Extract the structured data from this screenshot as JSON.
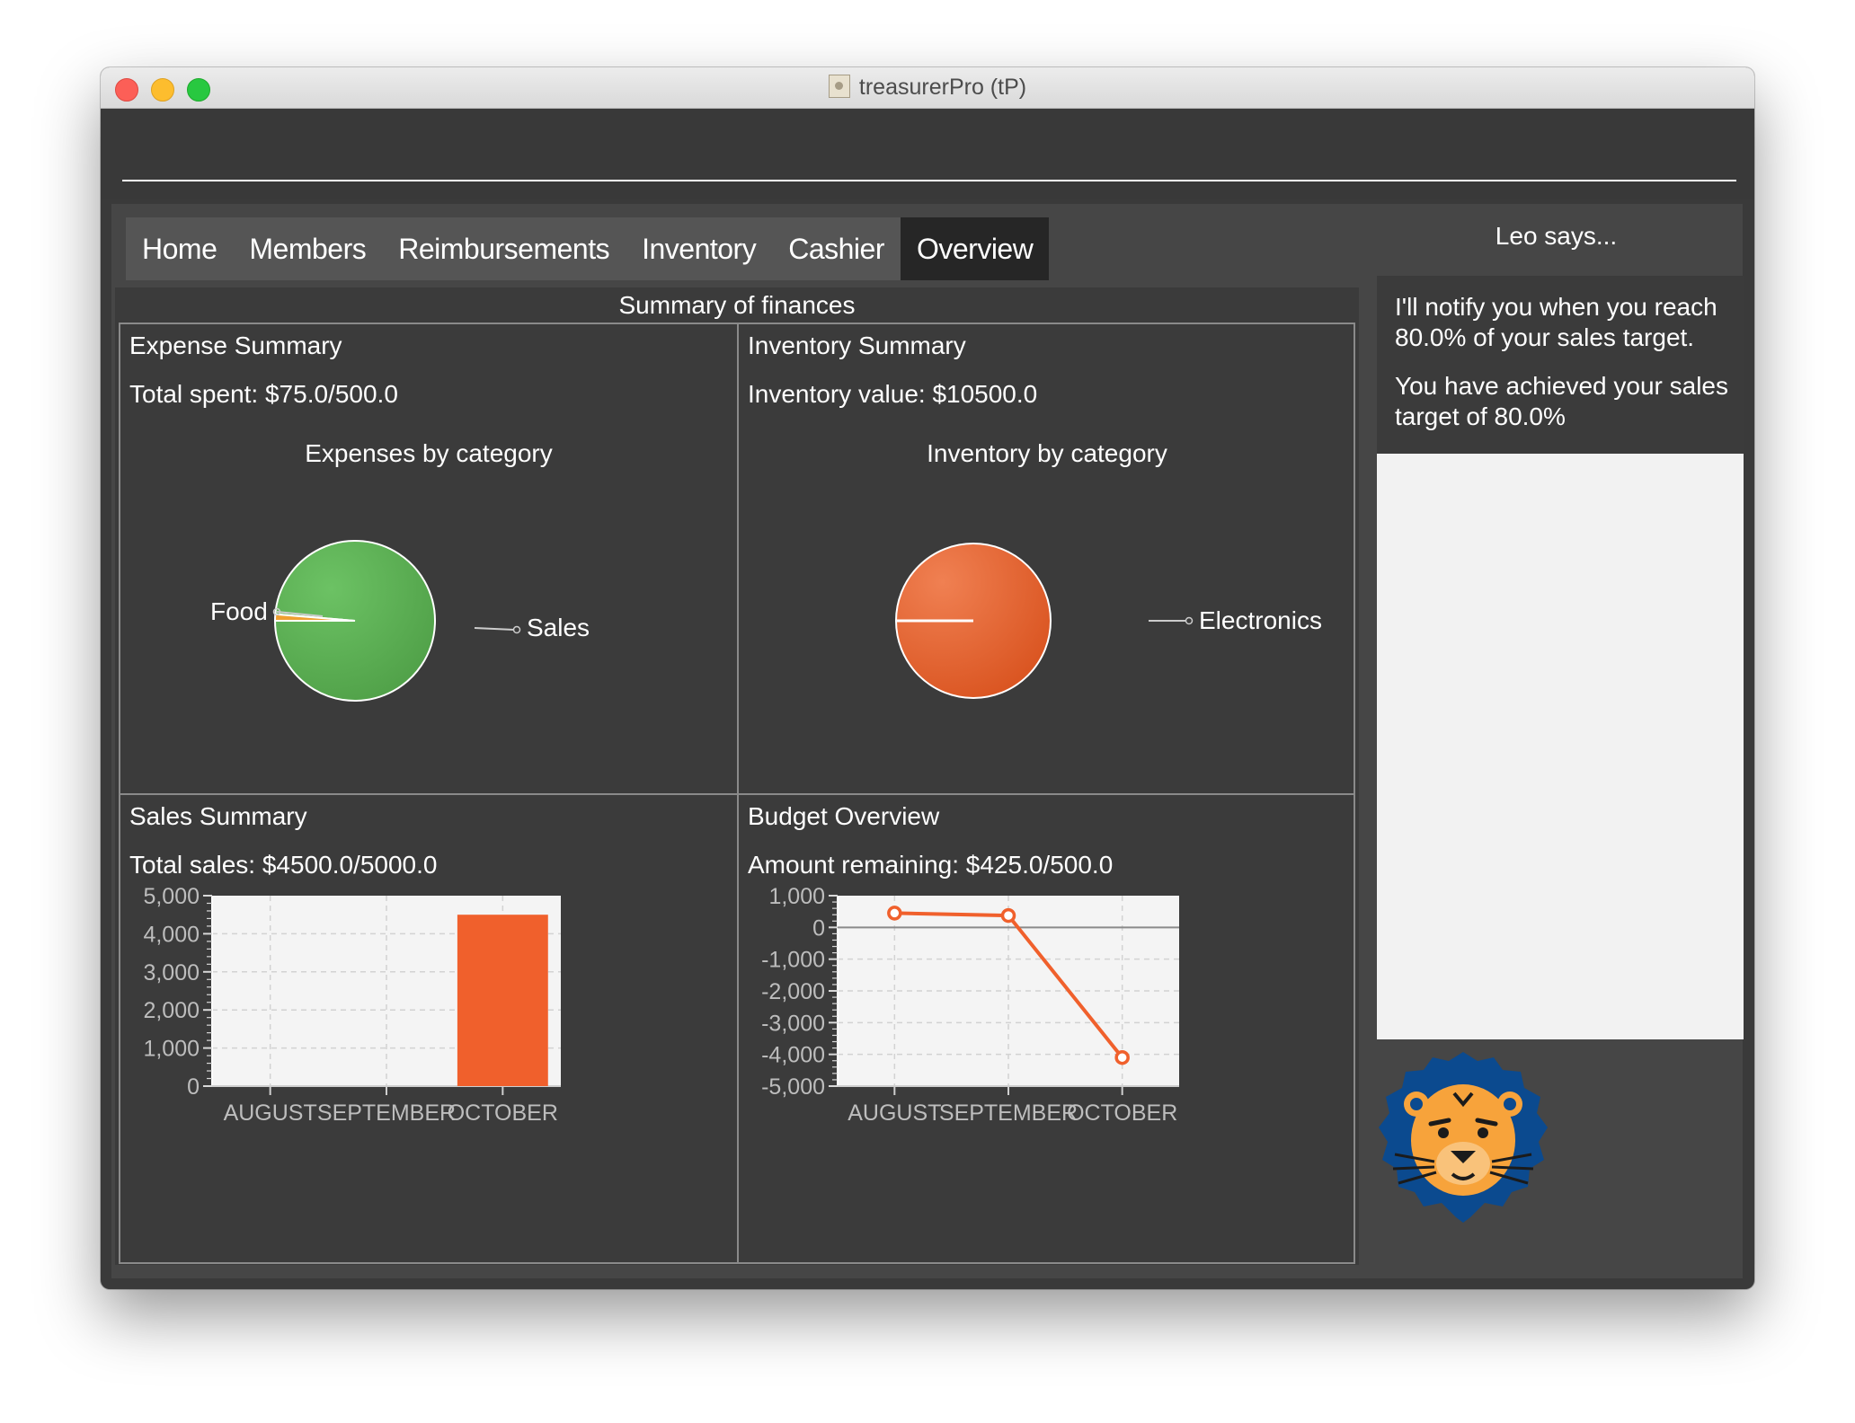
{
  "window": {
    "title": "treasurerPro (tP)"
  },
  "tabs": [
    {
      "label": "Home"
    },
    {
      "label": "Members"
    },
    {
      "label": "Reimbursements"
    },
    {
      "label": "Inventory"
    },
    {
      "label": "Cashier"
    },
    {
      "label": "Overview",
      "active": true
    }
  ],
  "overview": {
    "title": "Summary of finances",
    "expense": {
      "title": "Expense Summary",
      "value": "Total spent: $75.0/500.0",
      "chart_title": "Expenses by category",
      "labels": {
        "food": "Food",
        "sales": "Sales"
      }
    },
    "inventory": {
      "title": "Inventory Summary",
      "value": "Inventory value: $10500.0",
      "chart_title": "Inventory by category",
      "labels": {
        "electronics": "Electronics"
      }
    },
    "sales": {
      "title": "Sales Summary",
      "value": "Total sales: $4500.0/5000.0"
    },
    "budget": {
      "title": "Budget Overview",
      "value": "Amount remaining: $425.0/500.0"
    }
  },
  "assistant": {
    "title": "Leo says...",
    "messages": [
      "I'll notify you when you reach 80.0% of your sales target.",
      "You have achieved your sales target of 80.0%"
    ]
  },
  "colors": {
    "pie_green": "#58ad50",
    "pie_orange": "#e4602f",
    "bar_orange": "#f0602c",
    "line_orange": "#f0602c"
  },
  "chart_data": [
    {
      "type": "pie",
      "title": "Expenses by category",
      "slices": [
        {
          "label": "Sales",
          "value": 98.7,
          "color": "#58ad50"
        },
        {
          "label": "Food",
          "value": 1.3,
          "color": "#f0a030"
        }
      ]
    },
    {
      "type": "pie",
      "title": "Inventory by category",
      "slices": [
        {
          "label": "Electronics",
          "value": 100,
          "color": "#e4602f"
        }
      ]
    },
    {
      "type": "bar",
      "categories": [
        "AUGUST",
        "SEPTEMBER",
        "OCTOBER"
      ],
      "values": [
        0,
        0,
        4500
      ],
      "ylim": [
        0,
        5000
      ],
      "yticks": [
        "0",
        "1,000",
        "2,000",
        "3,000",
        "4,000",
        "5,000"
      ],
      "grid": true
    },
    {
      "type": "line",
      "categories": [
        "AUGUST",
        "SEPTEMBER",
        "OCTOBER"
      ],
      "values": [
        450,
        375,
        -4100
      ],
      "ylim": [
        -5000,
        1000
      ],
      "yticks": [
        "-5,000",
        "-4,000",
        "-3,000",
        "-2,000",
        "-1,000",
        "0",
        "1,000"
      ],
      "grid": true
    }
  ]
}
